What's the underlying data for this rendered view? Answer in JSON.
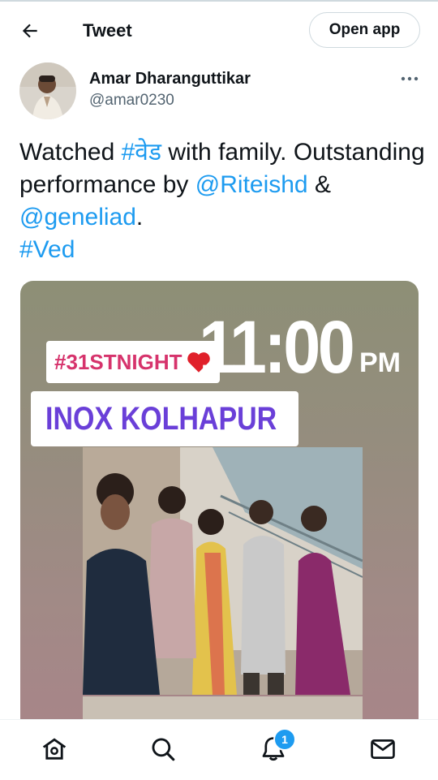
{
  "header": {
    "title": "Tweet",
    "open_app_label": "Open app"
  },
  "tweet": {
    "author_name": "Amar Dharanguttikar",
    "author_handle": "@amar0230",
    "text": {
      "part1": "Watched ",
      "hashtag1": "#वेड",
      "part2": " with family. Outstanding performance by ",
      "mention1": "@Riteishd",
      "part3": " & ",
      "mention2": "@geneliad",
      "part4": ".",
      "hashtag2": "#Ved"
    },
    "media": {
      "story_tag": "#31STNIGHT",
      "story_time": "11:00",
      "story_meridiem": "PM",
      "story_location": "INOX KOLHAPUR"
    }
  },
  "bottom_nav": {
    "items": [
      "home-icon",
      "search-icon",
      "notifications-icon",
      "messages-icon"
    ],
    "notification_count": "1"
  },
  "colors": {
    "link": "#1d9bf0",
    "text": "#0f1419",
    "secondary": "#536471"
  }
}
